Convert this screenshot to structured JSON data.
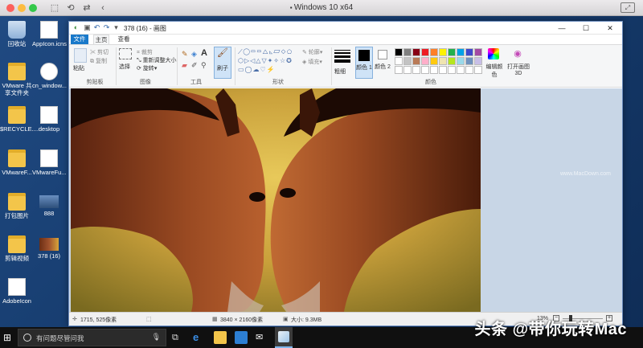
{
  "host": {
    "title": "Windows 10 x64",
    "colors": {
      "close": "#fc615d",
      "min": "#fdbc40",
      "max": "#34c84a"
    }
  },
  "desktop": {
    "icons": [
      {
        "label": "回收站",
        "kind": "bin"
      },
      {
        "label": "AppIcon.icns",
        "kind": "file"
      },
      {
        "label": "VMware 共享文件夹",
        "kind": "folder"
      },
      {
        "label": "cn_window...",
        "kind": "file"
      },
      {
        "label": "$RECYCLE....",
        "kind": "folder"
      },
      {
        "label": "desktop",
        "kind": "file"
      },
      {
        "label": "VMwareF...",
        "kind": "folder"
      },
      {
        "label": "VMwareFu...",
        "kind": "file"
      },
      {
        "label": "打包图片",
        "kind": "folder"
      },
      {
        "label": "888",
        "kind": "image"
      },
      {
        "label": "剪辑视频",
        "kind": "folder"
      },
      {
        "label": "378 (16)",
        "kind": "image"
      },
      {
        "label": "AdobeIcon",
        "kind": "file"
      }
    ]
  },
  "paint": {
    "title": "378 (16) - 画图",
    "tabs": [
      "文件",
      "主页",
      "查看"
    ],
    "ribbon": {
      "clipboard": {
        "paste": "粘贴",
        "cut": "剪切",
        "copy": "复制",
        "label": "剪贴板"
      },
      "image": {
        "select": "选择",
        "crop": "裁剪",
        "resize": "重新调整大小",
        "rotate": "旋转",
        "label": "图像"
      },
      "tools": {
        "label": "工具"
      },
      "brushes": {
        "label": "刷子"
      },
      "shapes": {
        "outline": "轮廓",
        "fill": "填充",
        "label": "形状"
      },
      "size": {
        "label": "粗细"
      },
      "colors": {
        "color1": "颜色 1",
        "color2": "颜色 2",
        "edit": "编辑颜色",
        "paint3d": "打开画图 3D",
        "label": "颜色"
      }
    },
    "palette": [
      "#000000",
      "#7f7f7f",
      "#880015",
      "#ed1c24",
      "#ff7f27",
      "#fff200",
      "#22b14c",
      "#00a2e8",
      "#3f48cc",
      "#a349a4",
      "#ffffff",
      "#c3c3c3",
      "#b97a57",
      "#ffaec9",
      "#ffc90e",
      "#efe4b0",
      "#b5e61d",
      "#99d9ea",
      "#7092be",
      "#c8bfe7"
    ],
    "status": {
      "cursor": "1715, 525像素",
      "dimensions": "3840 × 2160像素",
      "size": "大小: 9.3MB",
      "zoom": "13%"
    }
  },
  "taskbar": {
    "search_placeholder": "有问题尽管问我"
  },
  "watermark": {
    "main": "头条 @带你玩转Mac",
    "small": "www.MacDown.com"
  }
}
